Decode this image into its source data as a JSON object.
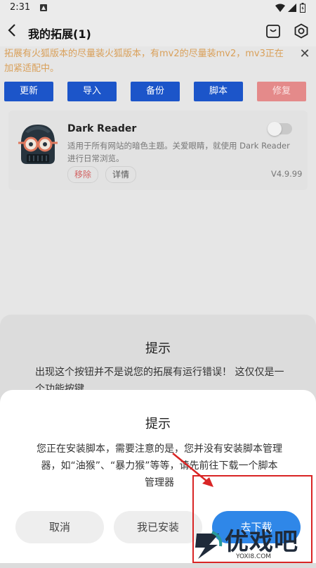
{
  "status_bar": {
    "time": "2:31"
  },
  "header": {
    "title": "我的拓展(1)"
  },
  "notice": {
    "text": "拓展有火狐版本的尽量装火狐版本，有mv2的尽量装mv2，mv3正在加紧适配中。"
  },
  "actions": [
    {
      "label": "更新"
    },
    {
      "label": "导入"
    },
    {
      "label": "备份"
    },
    {
      "label": "脚本"
    },
    {
      "label": "修复",
      "disabled": true
    }
  ],
  "extension": {
    "name": "Dark Reader",
    "description": "适用于所有网站的暗色主题。关爱眼睛，就使用 Dark Reader 进行日常浏览。",
    "remove_label": "移除",
    "details_label": "详情",
    "version": "V4.9.99",
    "enabled": false
  },
  "background_dialog": {
    "title": "提示",
    "message": "出现这个按钮并不是说您的拓展有运行错误！ 这仅仅是一个功能按键"
  },
  "dialog": {
    "title": "提示",
    "message": "您正在安装脚本，需要注意的是，您并没有安装脚本管理器，如“油猴”、“暴力猴”等等，请先前往下载一个脚本管理器",
    "cancel_label": "取消",
    "installed_label": "我已安装",
    "download_label": "去下载"
  },
  "watermark": {
    "text": "优戏吧",
    "sub": "YOXI8.COM"
  },
  "colors": {
    "primary": "#1c55c9",
    "accent": "#2f87e8",
    "warning": "#d9a05a",
    "annotation": "#d92525"
  }
}
